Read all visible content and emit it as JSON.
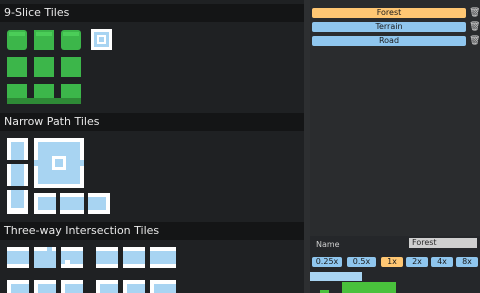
{
  "tileset": {
    "sections": [
      {
        "title": "9-Slice Tiles"
      },
      {
        "title": "Narrow Path Tiles"
      },
      {
        "title": "Three-way Intersection Tiles"
      }
    ]
  },
  "terrains": {
    "items": [
      {
        "label": "Forest",
        "selected": true
      },
      {
        "label": "Terrain",
        "selected": false
      },
      {
        "label": "Road",
        "selected": false
      }
    ],
    "delete_icon": "trash-icon"
  },
  "properties": {
    "name_label": "Name",
    "name_value": "Forest",
    "zoom_options": [
      "0.25x",
      "0.5x",
      "1x",
      "2x",
      "4x",
      "8x"
    ],
    "zoom_selected": "1x"
  },
  "colors": {
    "selected": "#ffc773",
    "normal": "#8fc6ee",
    "tile_green": "#49c13c",
    "tile_blue": "#a8d4f2"
  }
}
